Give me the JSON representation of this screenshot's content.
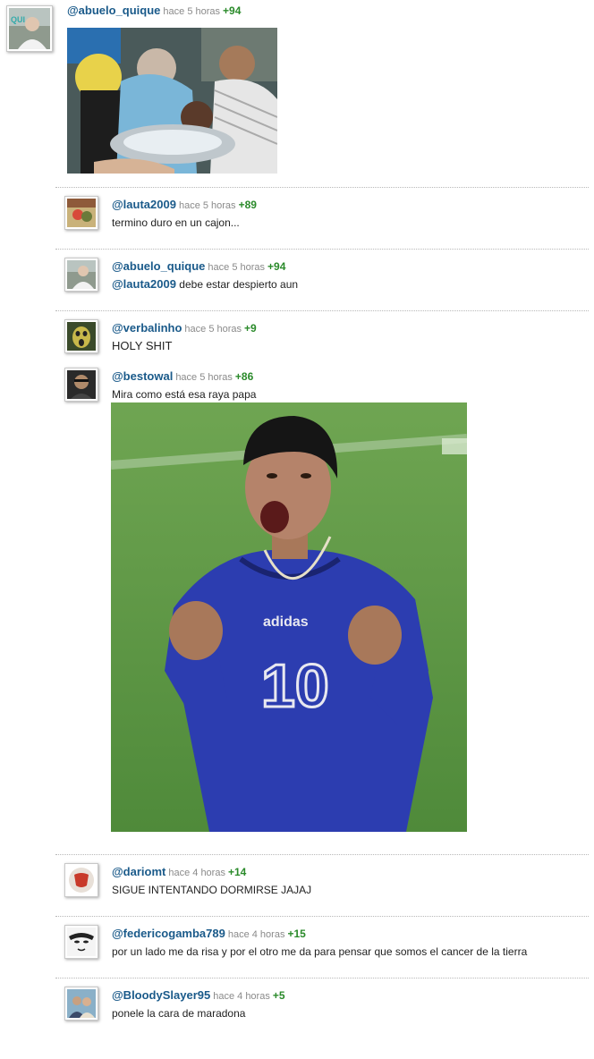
{
  "comments": [
    {
      "username": "@abuelo_quique",
      "time": "hace 5 horas",
      "score": "+94",
      "text": "",
      "avatar_icon": "old-man-avatar-icon",
      "image": "crowd-photo"
    },
    {
      "username": "@lauta2009",
      "time": "hace 5 horas",
      "score": "+89",
      "text": "termino duro en un cajon...",
      "avatar_icon": "cartoon-avatar-icon"
    },
    {
      "username": "@abuelo_quique",
      "time": "hace 5 horas",
      "score": "+94",
      "mention": "@lauta2009",
      "text": "debe estar despierto aun",
      "avatar_icon": "old-man-avatar-icon"
    },
    {
      "username": "@verbalinho",
      "time": "hace 5 horas",
      "score": "+9",
      "text": "HOLY SHIT",
      "avatar_icon": "screaming-face-avatar-icon"
    },
    {
      "username": "@bestowal",
      "time": "hace 5 horas",
      "score": "+86",
      "text": "Mira como está esa raya papa",
      "avatar_icon": "man-avatar-icon",
      "image": "football-player-photo",
      "image_text": {
        "brand": "adidas",
        "number": "10"
      }
    },
    {
      "username": "@dariomt",
      "time": "hace 4 horas",
      "score": "+14",
      "text": "SIGUE INTENTANDO DORMIRSE JAJAJ",
      "avatar_icon": "ball-face-avatar-icon"
    },
    {
      "username": "@federicogamba789",
      "time": "hace 4 horas",
      "score": "+15",
      "text": "por un lado me da risa y por el otro me da para pensar que somos el cancer de la tierra",
      "avatar_icon": "mask-face-avatar-icon"
    },
    {
      "username": "@BloodySlayer95",
      "time": "hace 4 horas",
      "score": "+5",
      "text": "ponele la cara de maradona",
      "avatar_icon": "couple-avatar-icon"
    }
  ],
  "colors": {
    "username": "#1a5a8a",
    "score": "#2a8a2a",
    "time": "#8a8a8a"
  }
}
